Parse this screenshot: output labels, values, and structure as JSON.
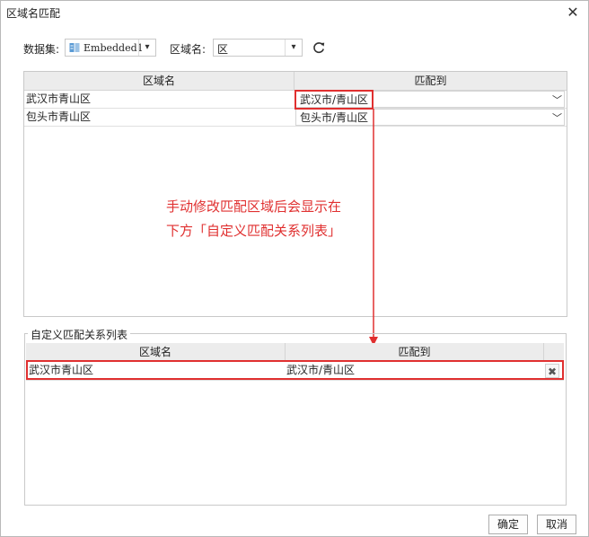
{
  "window": {
    "title": "区域名匹配",
    "close_icon": "close-icon"
  },
  "toolbar": {
    "dataset_label": "数据集:",
    "dataset_value": "Embedded1",
    "region_label": "区域名:",
    "region_value": "区",
    "refresh_icon": "refresh-icon"
  },
  "match_table": {
    "columns": [
      "区域名",
      "匹配到"
    ],
    "rows": [
      {
        "region": "武汉市青山区",
        "match": "武汉市/青山区"
      },
      {
        "region": "包头市青山区",
        "match": "包头市/青山区"
      }
    ]
  },
  "annotation": {
    "line1": "手动修改匹配区域后会显示在",
    "line2": "下方「自定义匹配关系列表」",
    "color": "#e03030"
  },
  "custom_table": {
    "title": "自定义匹配关系列表",
    "columns": [
      "区域名",
      "匹配到"
    ],
    "rows": [
      {
        "region": "武汉市青山区",
        "match": "武汉市/青山区",
        "delete_icon": "delete-icon"
      }
    ]
  },
  "footer": {
    "ok_label": "确定",
    "cancel_label": "取消"
  }
}
